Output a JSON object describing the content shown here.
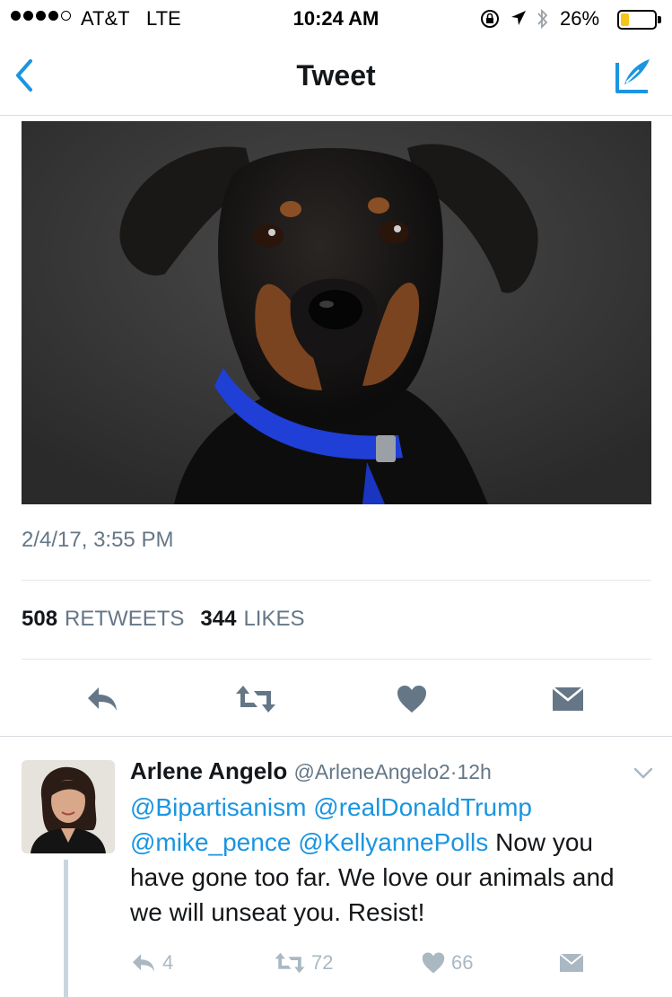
{
  "status_bar": {
    "carrier": "AT&T",
    "network": "LTE",
    "time": "10:24 AM",
    "battery_percent": "26%",
    "battery_level": 0.26,
    "battery_color": "#f5c518"
  },
  "nav": {
    "title": "Tweet",
    "back_icon": "chevron-left-icon",
    "compose_icon": "compose-feather-icon",
    "accent_color": "#1b95e0"
  },
  "tweet": {
    "photo": "black-and-tan-puppy-with-blue-collar",
    "timestamp": "2/4/17, 3:55 PM",
    "retweet_count": "508",
    "retweets_label": "RETWEETS",
    "like_count": "344",
    "likes_label": "LIKES",
    "actions": [
      "reply-icon",
      "retweet-icon",
      "heart-icon",
      "envelope-icon"
    ]
  },
  "reply": {
    "name": "Arlene Angelo",
    "handle": "@ArleneAngelo2",
    "separator": "·",
    "age": "12h",
    "mentions": [
      "@Bipartisanism",
      "@realDonaldTrump",
      "@mike_pence",
      "@KellyannePolls"
    ],
    "text": "Now you have gone too far. We love our animals and we will unseat you. Resist!",
    "reply_count": "4",
    "retweet_count": "72",
    "like_count": "66"
  }
}
